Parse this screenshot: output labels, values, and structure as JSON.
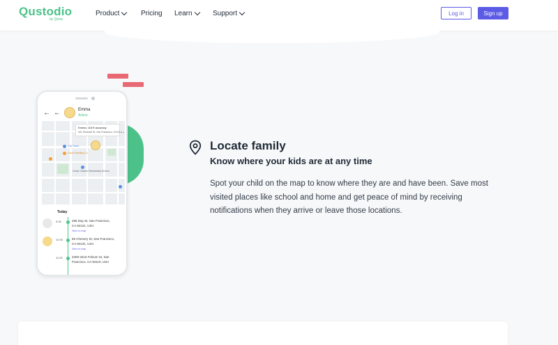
{
  "header": {
    "logo_text": "Qustodio",
    "logo_sub": "by Qoria",
    "nav": [
      {
        "label": "Product",
        "has_dropdown": true
      },
      {
        "label": "Pricing",
        "has_dropdown": false
      },
      {
        "label": "Learn",
        "has_dropdown": true
      },
      {
        "label": "Support",
        "has_dropdown": true
      }
    ],
    "login_label": "Log in",
    "signup_label": "Sign up"
  },
  "phone": {
    "child_name": "Emma",
    "child_status": "Active",
    "map_card_title": "Emma, 115 ft accuracy",
    "map_card_address": "401 Shotwell St, San Francisco, CA 94110, USA",
    "map_labels": [
      "Cell Tower",
      "Good Seedling Co.",
      "Cesar Chavez Elementary School"
    ],
    "timeline_today": "Today",
    "timeline": [
      {
        "time": "9:30",
        "addr1": "295 Day St, San Francisco,",
        "addr2": "CA 94131, USA",
        "link": "View on map"
      },
      {
        "time": "10:30",
        "addr1": "65 Chenery St, San Francisco,",
        "addr2": "CA 94131, USA",
        "link": "View on map"
      },
      {
        "time": "11:30",
        "addr1": "3400-3416 Folsom St, San",
        "addr2": "Francisco, CA 94110, USA",
        "link": ""
      }
    ]
  },
  "feature": {
    "icon": "location-pin-icon",
    "title": "Locate family",
    "subtitle": "Know where your kids are at any time",
    "body": "Spot your child on the map to know where they are and have been. Save most visited places like school and home and get peace of mind by receiving notifications when they arrive or leave those locations."
  },
  "colors": {
    "brand_green": "#4cc28a",
    "accent_purple": "#5b5be6",
    "deco_red": "#e86873"
  }
}
